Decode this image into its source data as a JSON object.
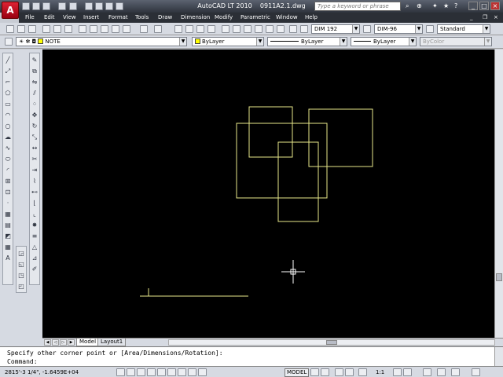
{
  "window": {
    "app": "AutoCAD LT 2010",
    "file": "0911A2.1.dwg",
    "logo": "A"
  },
  "search": {
    "placeholder": "Type a keyword or phrase"
  },
  "menu": [
    "File",
    "Edit",
    "View",
    "Insert",
    "Format",
    "Tools",
    "Draw",
    "Dimension",
    "Modify",
    "Parametric",
    "Window",
    "Help"
  ],
  "toolbar": {
    "dimstyle": "DIM 192",
    "dimstyle2": "DIM-96",
    "textstyle": "Standard"
  },
  "properties": {
    "layer": "NOTE",
    "color": "ByLayer",
    "linetype": "ByLayer",
    "lineweight": "ByLayer",
    "plotstyle": "ByColor"
  },
  "tabs": [
    "Model",
    "Layout1"
  ],
  "command": {
    "history": "Specify other corner point or [Area/Dimensions/Rotation]:",
    "prompt": "Command:"
  },
  "status": {
    "coords": "2815'-3 1/4\", -1.6459E+04",
    "model": "MODEL",
    "scale": "1:1"
  },
  "colors": {
    "canvas": "#000000",
    "geometry": "#e8e88a",
    "layer_swatch": "#ffff00",
    "line_white": "#ffffff"
  },
  "icons": [
    "grips-icon",
    "line-icon",
    "pan-icon",
    "zoom-icon",
    "layer-icon",
    "command-icon"
  ]
}
